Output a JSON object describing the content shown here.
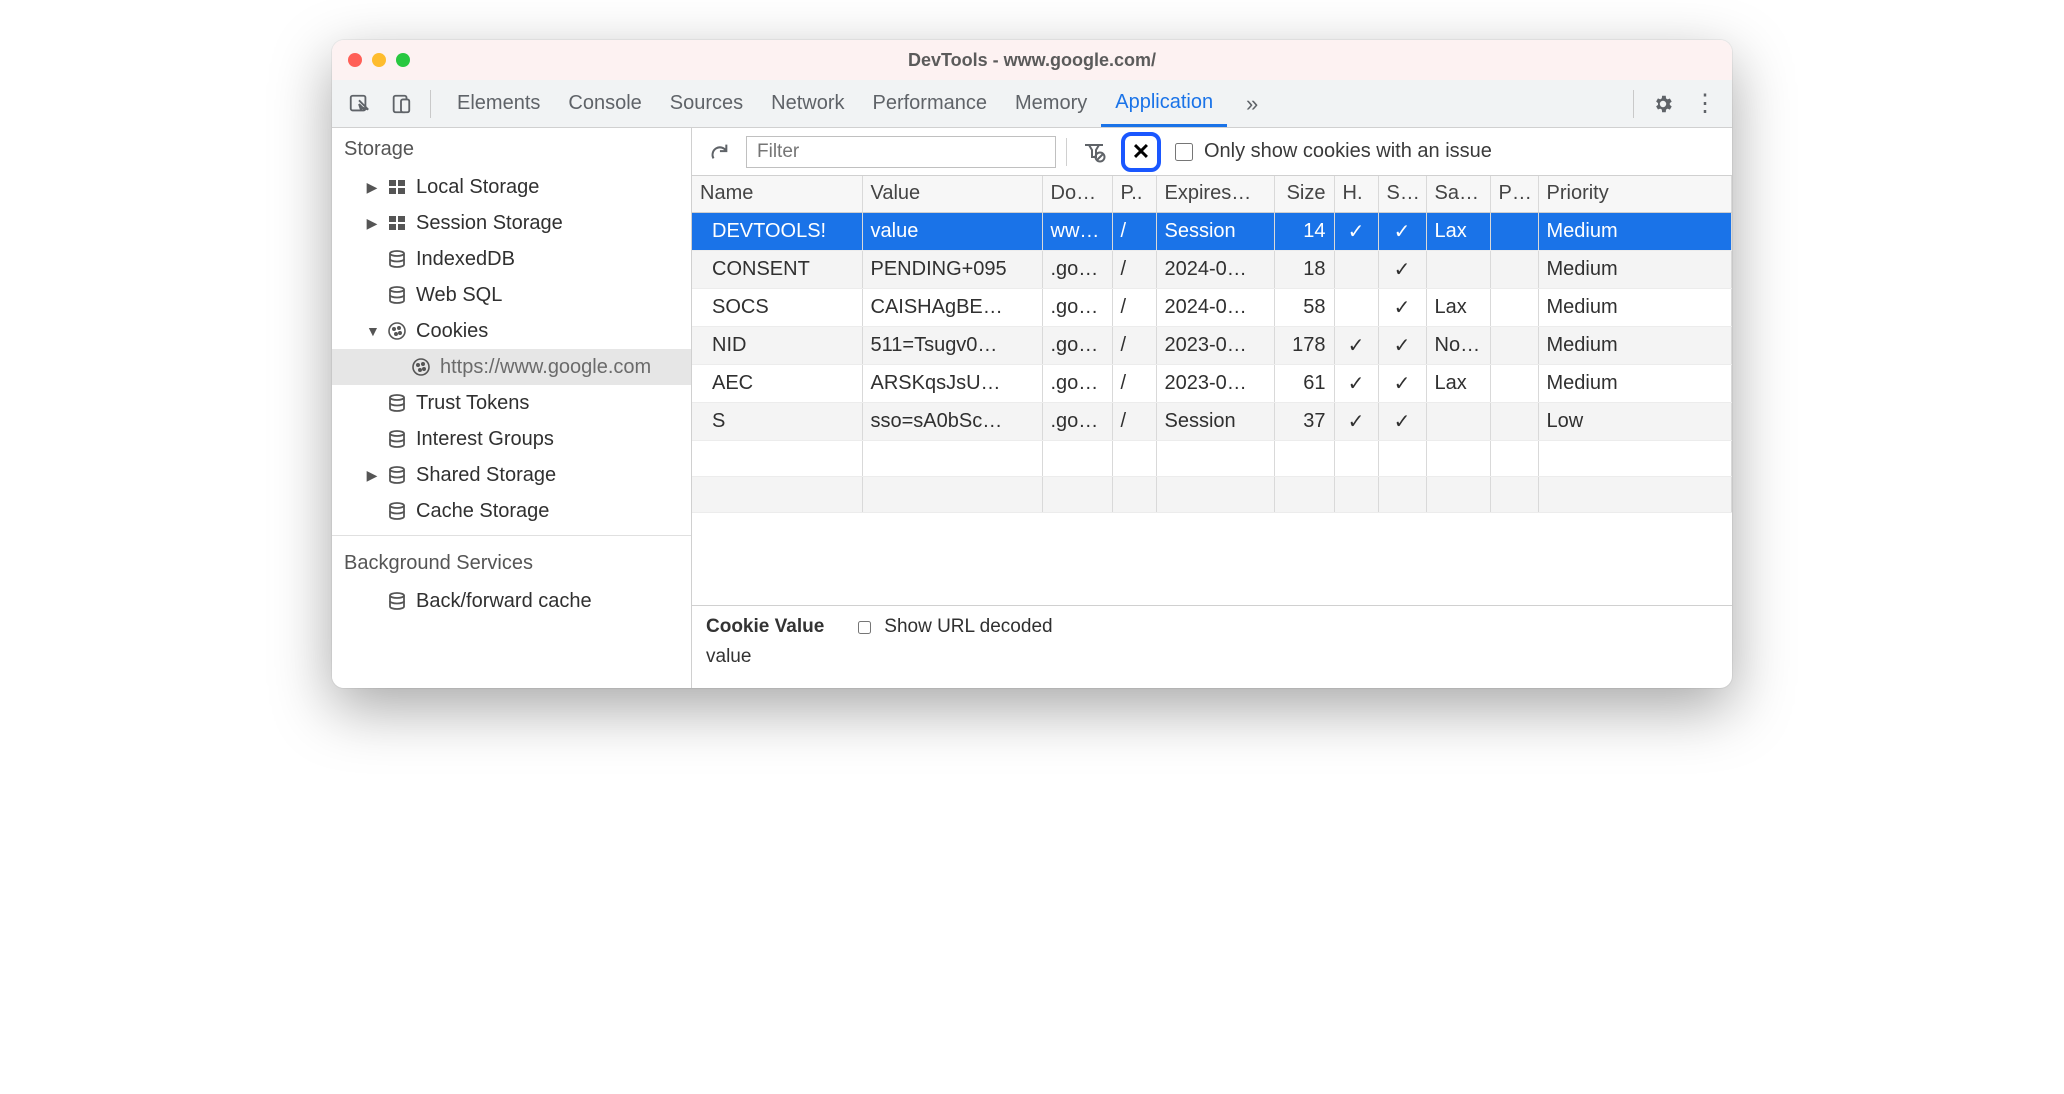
{
  "window": {
    "title": "DevTools - www.google.com/"
  },
  "tabs": {
    "items": [
      "Elements",
      "Console",
      "Sources",
      "Network",
      "Performance",
      "Memory",
      "Application"
    ],
    "active": "Application"
  },
  "sidebar": {
    "storage_head": "Storage",
    "items": [
      {
        "label": "Local Storage",
        "icon": "grid",
        "expander": "right",
        "indent": 1
      },
      {
        "label": "Session Storage",
        "icon": "grid",
        "expander": "right",
        "indent": 1
      },
      {
        "label": "IndexedDB",
        "icon": "db",
        "expander": "none",
        "indent": 1
      },
      {
        "label": "Web SQL",
        "icon": "db",
        "expander": "none",
        "indent": 1
      },
      {
        "label": "Cookies",
        "icon": "cookie",
        "expander": "down",
        "indent": 1
      },
      {
        "label": "https://www.google.com",
        "icon": "cookie",
        "expander": "none",
        "indent": 2,
        "selected": true
      },
      {
        "label": "Trust Tokens",
        "icon": "db",
        "expander": "none",
        "indent": 1
      },
      {
        "label": "Interest Groups",
        "icon": "db",
        "expander": "none",
        "indent": 1
      },
      {
        "label": "Shared Storage",
        "icon": "db",
        "expander": "right",
        "indent": 1
      },
      {
        "label": "Cache Storage",
        "icon": "db",
        "expander": "none",
        "indent": 1
      }
    ],
    "bg_head": "Background Services",
    "bg_items": [
      {
        "label": "Back/forward cache",
        "icon": "db",
        "indent": 1
      }
    ]
  },
  "toolbar": {
    "filter_placeholder": "Filter",
    "only_issues_label": "Only show cookies with an issue"
  },
  "columns": [
    "Name",
    "Value",
    "Do…",
    "P..",
    "Expires…",
    "Size",
    "H.",
    "S…",
    "Sa…",
    "P…",
    "Priority"
  ],
  "rows": [
    {
      "name": "DEVTOOLS!",
      "value": "value",
      "domain": "ww…",
      "path": "/",
      "expires": "Session",
      "size": "14",
      "http": "✓",
      "secure": "✓",
      "same": "Lax",
      "part": "",
      "priority": "Medium",
      "selected": true
    },
    {
      "name": "CONSENT",
      "value": "PENDING+095",
      "domain": ".go…",
      "path": "/",
      "expires": "2024-0…",
      "size": "18",
      "http": "",
      "secure": "✓",
      "same": "",
      "part": "",
      "priority": "Medium"
    },
    {
      "name": "SOCS",
      "value": "CAISHAgBE…",
      "domain": ".go…",
      "path": "/",
      "expires": "2024-0…",
      "size": "58",
      "http": "",
      "secure": "✓",
      "same": "Lax",
      "part": "",
      "priority": "Medium"
    },
    {
      "name": "NID",
      "value": "511=Tsugv0…",
      "domain": ".go…",
      "path": "/",
      "expires": "2023-0…",
      "size": "178",
      "http": "✓",
      "secure": "✓",
      "same": "No…",
      "part": "",
      "priority": "Medium"
    },
    {
      "name": "AEC",
      "value": "ARSKqsJsU…",
      "domain": ".go…",
      "path": "/",
      "expires": "2023-0…",
      "size": "61",
      "http": "✓",
      "secure": "✓",
      "same": "Lax",
      "part": "",
      "priority": "Medium"
    },
    {
      "name": "S",
      "value": "sso=sA0bSc…",
      "domain": ".go…",
      "path": "/",
      "expires": "Session",
      "size": "37",
      "http": "✓",
      "secure": "✓",
      "same": "",
      "part": "",
      "priority": "Low"
    }
  ],
  "detail": {
    "label": "Cookie Value",
    "decoded_label": "Show URL decoded",
    "value": "value"
  }
}
